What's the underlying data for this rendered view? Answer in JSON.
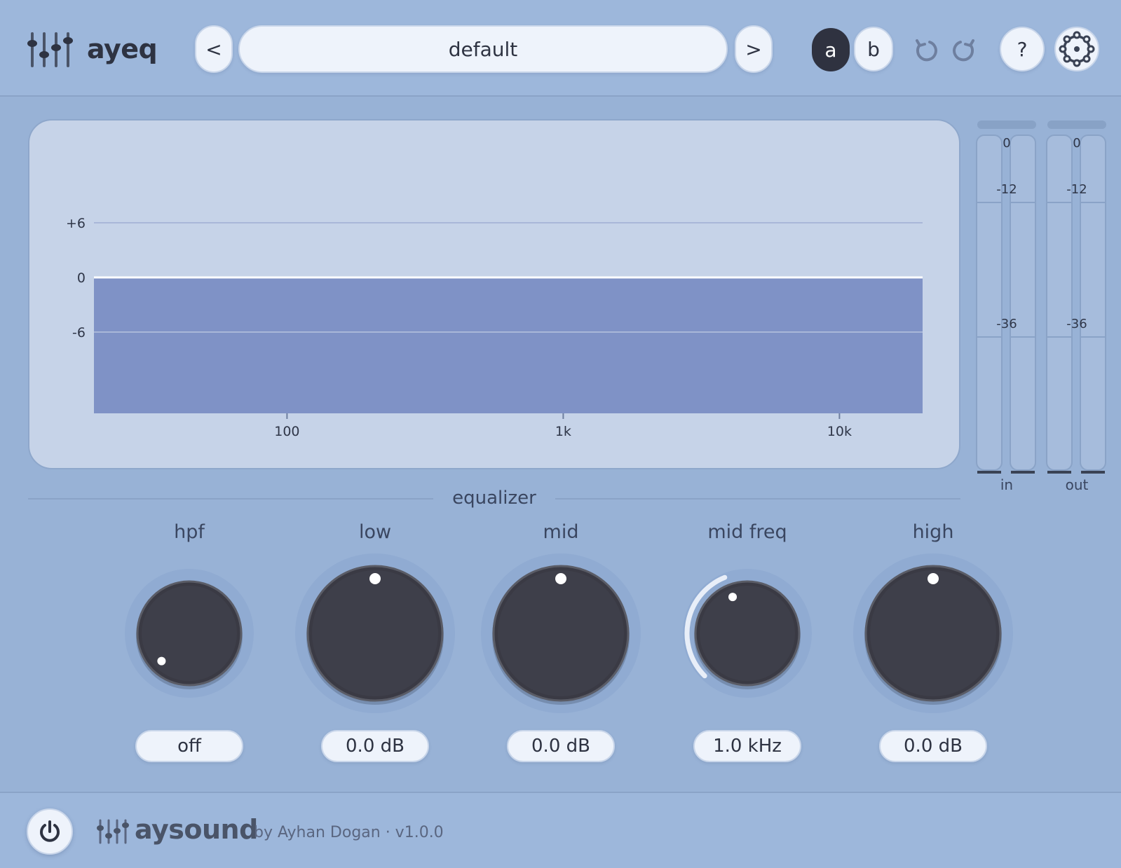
{
  "app": {
    "title": "ayeq"
  },
  "header": {
    "prev_label": "<",
    "preset_name": "default",
    "next_label": ">",
    "ab_a": "a",
    "ab_b": "b",
    "help_label": "?"
  },
  "eq_display": {
    "y_ticks": [
      "+6",
      "0",
      "-6"
    ],
    "x_ticks": [
      "100",
      "1k",
      "10k"
    ],
    "curve_gain_db": 0
  },
  "meters": {
    "in": {
      "label": "in",
      "ticks": [
        "0",
        "-12",
        "-36"
      ]
    },
    "out": {
      "label": "out",
      "ticks": [
        "0",
        "-12",
        "-36"
      ]
    }
  },
  "section": {
    "title": "equalizer"
  },
  "knobs": [
    {
      "label": "hpf",
      "value": "off"
    },
    {
      "label": "low",
      "value": "0.0 dB"
    },
    {
      "label": "mid",
      "value": "0.0 dB"
    },
    {
      "label": "mid freq",
      "value": "1.0 kHz"
    },
    {
      "label": "high",
      "value": "0.0 dB"
    }
  ],
  "footer": {
    "brand": "aysound",
    "byline": "by Ayhan Dogan  ·  v1.0.0"
  },
  "colors": {
    "background": "#98b2d6",
    "panel": "#c6d3e8",
    "eq_fill": "#7f92c6",
    "knob": "#3a3a44",
    "accent_dark": "#2f3240"
  },
  "icons": {
    "logo": "sliders-icon",
    "undo": "undo-icon",
    "redo": "redo-icon",
    "settings": "gear-icon",
    "power": "power-icon"
  }
}
